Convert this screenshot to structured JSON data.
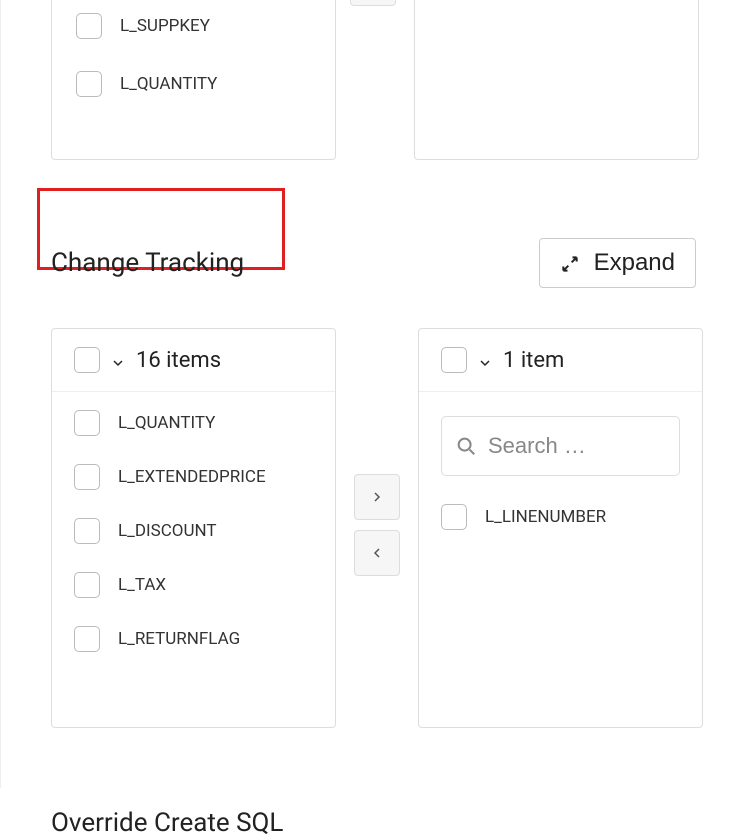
{
  "top_section": {
    "left_items": [
      "L_SUPPKEY",
      "L_QUANTITY"
    ],
    "right_items": []
  },
  "change_tracking": {
    "title": "Change Tracking",
    "expand_label": "Expand",
    "left_header_count": "16 items",
    "right_header_count": "1 item",
    "search_placeholder": "Search …",
    "left_items": [
      "L_QUANTITY",
      "L_EXTENDEDPRICE",
      "L_DISCOUNT",
      "L_TAX",
      "L_RETURNFLAG"
    ],
    "right_items": [
      "L_LINENUMBER"
    ]
  },
  "override_sql": {
    "title": "Override Create SQL"
  }
}
